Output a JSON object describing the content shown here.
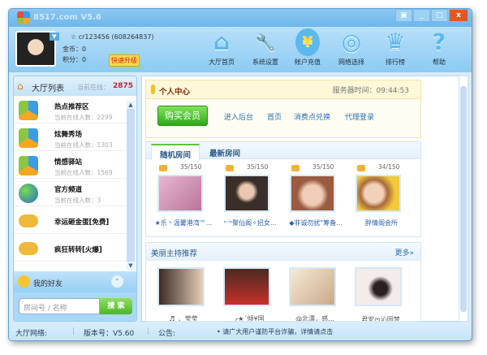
{
  "window": {
    "title": "8517.com V5.6",
    "buttons": [
      "▣",
      "_",
      "□",
      "x"
    ]
  },
  "user": {
    "name": "cr123456 (608264837)",
    "coins_label": "金币：",
    "coins": "0",
    "points_label": "积分：",
    "points": "0",
    "upgrade": "快速升级"
  },
  "nav": [
    {
      "label": "大厅首页",
      "icon": "⌂"
    },
    {
      "label": "系统设置",
      "icon": "🔧"
    },
    {
      "label": "帐户充值",
      "icon": "¥"
    },
    {
      "label": "网络选择",
      "icon": "◎"
    },
    {
      "label": "排行榜",
      "icon": "♛"
    },
    {
      "label": "帮助",
      "icon": "?"
    }
  ],
  "hall": {
    "title": "大厅列表",
    "online_label": "当前在线：",
    "online": "2875",
    "items": [
      {
        "name": "热点推荐区",
        "count": "当前在线人数：2299"
      },
      {
        "name": "炫舞秀场",
        "count": "当前在线人数：1303"
      },
      {
        "name": "情感驿站",
        "count": "当前在线人数：1569"
      },
      {
        "name": "官方频道",
        "count": "当前在线人数：3"
      },
      {
        "name": "幸运砸金蛋[免费]",
        "count": ""
      },
      {
        "name": "疯狂转转[火爆]",
        "count": ""
      }
    ]
  },
  "friends": {
    "label": "我的好友",
    "search_placeholder": "房间号 / 名称",
    "search_button": "搜 索"
  },
  "personal": {
    "title": "个人中心",
    "server_time": "服务器时间：09:44:53",
    "buy": "购买会员",
    "links": [
      "进入后台",
      "首页",
      "消费点兑换",
      "代理登录"
    ]
  },
  "rooms": {
    "tabs": [
      "随机房间",
      "最新房间"
    ],
    "items": [
      {
        "count": "35/150",
        "name": "★乐丶温馨港湾™..."
      },
      {
        "count": "35/150",
        "name": "ⁿ⁼ʰ聚仙阁✧招女..."
      },
      {
        "count": "35/150",
        "name": "◆非诚勿扰\"筹备..."
      },
      {
        "count": "34/150",
        "name": "醉情阁会所"
      }
    ]
  },
  "hosts": {
    "title": "美丽主持推荐",
    "more": "更多»",
    "items": [
      "♬_、莹莹",
      "╭★ˊ倾¥国",
      "@北漂，感...",
      "君安ᰔ沁园梦"
    ]
  },
  "status": {
    "network": "大厅网络:",
    "version": "版本号：V5.60",
    "notice_label": "公告:",
    "notice": "• 请广大用户谨防平台诈骗，详情请点击"
  }
}
